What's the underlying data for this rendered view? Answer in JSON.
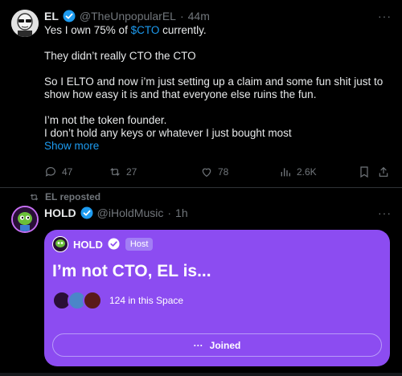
{
  "post1": {
    "author_name": "EL",
    "author_handle": "@TheUnpopularEL",
    "separator": "·",
    "time": "44m",
    "more": "···",
    "line1_pre": "Yes I own 75% of ",
    "line1_cashtag": "$CTO",
    "line1_post": " currently.",
    "para2": "They didn’t really CTO the CTO",
    "para3": "So I ELTO and now i’m just setting up a claim and some fun shit just to show how easy it is and that everyone else ruins the fun.",
    "para4_line1": "I’m not the token founder.",
    "para4_line2": "I don’t hold any keys or whatever I just bought most",
    "show_more": "Show more",
    "replies": "47",
    "reposts": "27",
    "likes": "78",
    "views": "2.6K"
  },
  "repost_banner": "EL reposted",
  "post2": {
    "author_name": "HOLD",
    "author_handle": "@iHoldMusic",
    "separator": "·",
    "time": "1h",
    "more": "···"
  },
  "space": {
    "host_name": "HOLD",
    "host_badge": "Host",
    "title": "I’m not CTO, EL is...",
    "listeners": "124 in this Space",
    "button_dots": "···",
    "button_label": "Joined"
  },
  "colors": {
    "accent": "#1d9bf0",
    "space_bg": "#8c4cf1",
    "muted": "#71767b"
  }
}
